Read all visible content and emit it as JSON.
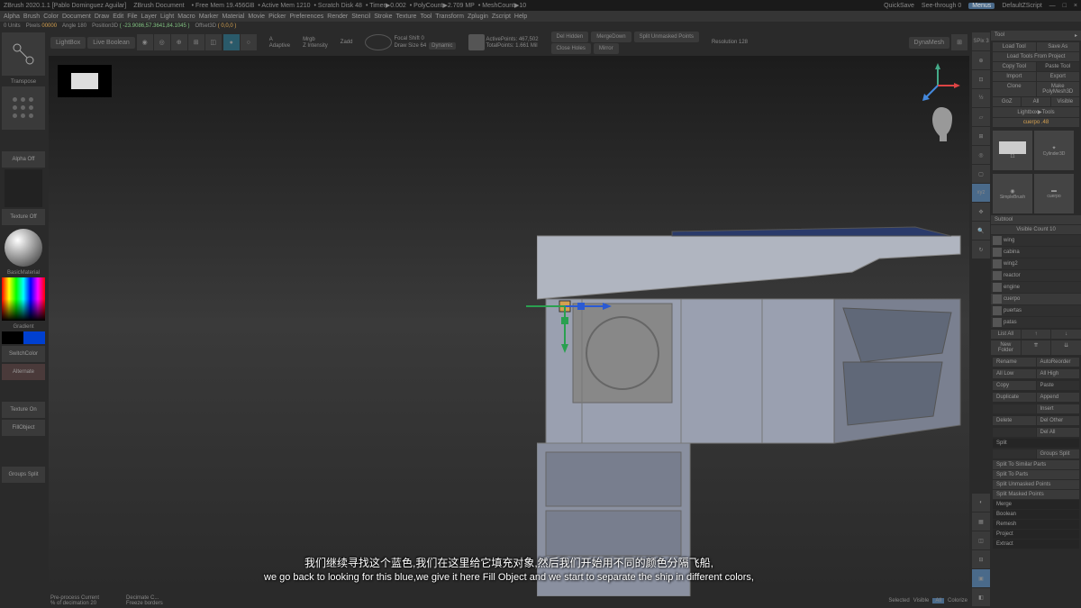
{
  "titlebar": {
    "app": "ZBrush 2020.1.1 [Pablo Dominguez Aguilar]",
    "doc": "ZBrush Document",
    "mem": "Free Mem 19.456GB",
    "activemem": "Active Mem 1210",
    "scratch": "Scratch Disk 48",
    "timer": "Timer▶0.002",
    "poly": "PolyCount▶2.709 MP",
    "mesh": "MeshCount▶10",
    "quicksave": "QuickSave",
    "seethrough": "See-through 0",
    "menus": "Menus",
    "script": "DefaultZScript"
  },
  "menubar": [
    "Alpha",
    "Brush",
    "Color",
    "Document",
    "Draw",
    "Edit",
    "File",
    "Layer",
    "Light",
    "Macro",
    "Marker",
    "Material",
    "Movie",
    "Picker",
    "Preferences",
    "Render",
    "Stencil",
    "Stroke",
    "Texture",
    "Tool",
    "Transform",
    "Zplugin",
    "Zscript",
    "Help"
  ],
  "coordbar": {
    "units": "0 Units",
    "pixels": "Pixels 00000",
    "angle": "Angle 180",
    "pos": "Position3D ( -23.9086,57.3641,84.1045 )",
    "offset": "Offset3D ( 0,0,0 )"
  },
  "left": {
    "transpose": "Transpose",
    "alpha": "Alpha Off",
    "texture": "Texture Off",
    "material": "BasicMaterial",
    "gradient": "Gradient",
    "switchcolor": "SwitchColor",
    "alternate": "Alternate",
    "textureon": "Texture On",
    "fillobject": "FillObject",
    "groupssplit": "Groups Split"
  },
  "toolbar": {
    "lightbox": "LightBox",
    "liveboolean": "Live Boolean",
    "focal": "Focal Shift 0",
    "drawsize": "Draw Size 64",
    "dynamic": "Dynamic",
    "activepoints": "ActivePoints: 467,502",
    "totalpoints": "TotalPoints: 1.661 Mil",
    "delhidden": "Del Hidden",
    "mergedown": "MergeDown",
    "splitunmasked": "Split Unmasked Points",
    "closeholes": "Close Holes",
    "mirror": "Mirror",
    "resolution": "Resolution 128",
    "dynamesh": "DynaMesh"
  },
  "rightpanel": {
    "tool": "Tool",
    "loadtool": "Load Tool",
    "saveas": "Save As",
    "loadfromproj": "Load Tools From Project",
    "copytool": "Copy Tool",
    "pastetool": "Paste Tool",
    "import": "Import",
    "export": "Export",
    "clone": "Clone",
    "makepoly": "Make PolyMesh3D",
    "goz": "GoZ",
    "all": "All",
    "visible": "Visible",
    "lightbox": "Lightbox▶Tools",
    "cuerpo": "cuerpo .48",
    "cylinder": "Cylinder3D",
    "simplebrush": "SimpleBrush",
    "cuerpo2": "cuerpo",
    "polymesh": "PolyMesh3D",
    "subtool": "Subtool",
    "visiblecount": "Visible Count 10",
    "subtools": [
      "wing",
      "cabina",
      "wing2",
      "reactor",
      "engine",
      "cuerpo",
      "puertas",
      "patas"
    ],
    "listall": "List All",
    "newfolder": "New Folder",
    "rename": "Rename",
    "autoreorder": "AutoReorder",
    "alllow": "All Low",
    "allhigh": "All High",
    "copy": "Copy",
    "paste": "Paste",
    "duplicate": "Duplicate",
    "append": "Append",
    "insert": "Insert",
    "delete": "Delete",
    "delother": "Del Other",
    "delall": "Del All",
    "split": "Split",
    "groupssplit": "Groups Split",
    "splitsimilar": "Split To Similar Parts",
    "splittoparts": "Split To Parts",
    "splitunmasked": "Split Unmasked Points",
    "splitmasked": "Split Masked Points",
    "merge": "Merge",
    "boolean": "Boolean",
    "remesh": "Remesh",
    "project": "Project",
    "extract": "Extract"
  },
  "bottom": {
    "preprocess": "Pre-process Current",
    "decimation": "% of decimation 20",
    "decimate": "Decimate C...",
    "freeze": "Freeze borders",
    "selected": "Selected",
    "visible": "Visible",
    "all": "All",
    "colorize": "Colorize"
  },
  "caption": {
    "cn": "我们继续寻找这个蓝色,我们在这里给它填充对象,然后我们开始用不同的颜色分隔飞船,",
    "en": "we go back to looking for this blue,we give it here Fill Object and we start to separate the ship in different colors,"
  },
  "righttools": [
    "SPix 3",
    "Scroll",
    "Actual",
    "AAHalf",
    "Persp",
    "Floor",
    "Local",
    "Frame",
    "XYZ",
    "LineF"
  ]
}
